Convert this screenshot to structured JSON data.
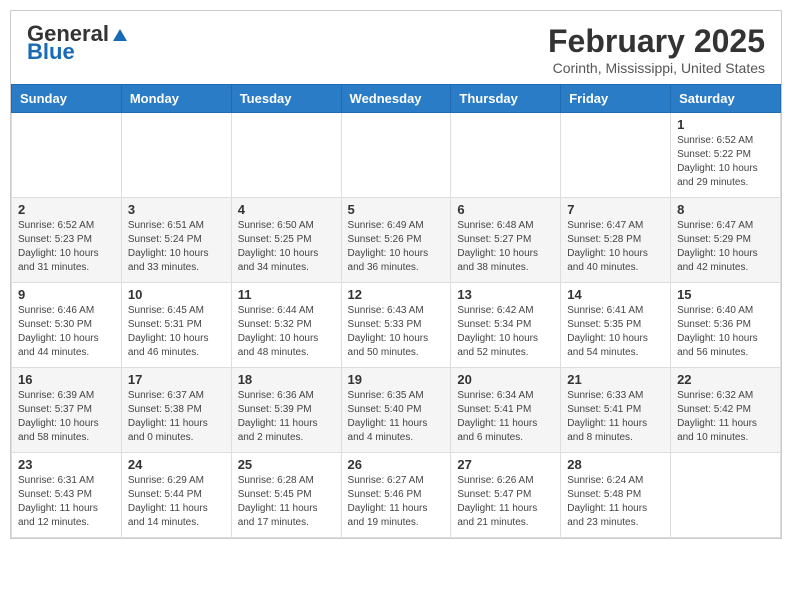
{
  "header": {
    "logo_general": "General",
    "logo_blue": "Blue",
    "month_title": "February 2025",
    "location": "Corinth, Mississippi, United States"
  },
  "days_of_week": [
    "Sunday",
    "Monday",
    "Tuesday",
    "Wednesday",
    "Thursday",
    "Friday",
    "Saturday"
  ],
  "weeks": [
    [
      {
        "day": "",
        "info": ""
      },
      {
        "day": "",
        "info": ""
      },
      {
        "day": "",
        "info": ""
      },
      {
        "day": "",
        "info": ""
      },
      {
        "day": "",
        "info": ""
      },
      {
        "day": "",
        "info": ""
      },
      {
        "day": "1",
        "info": "Sunrise: 6:52 AM\nSunset: 5:22 PM\nDaylight: 10 hours and 29 minutes."
      }
    ],
    [
      {
        "day": "2",
        "info": "Sunrise: 6:52 AM\nSunset: 5:23 PM\nDaylight: 10 hours and 31 minutes."
      },
      {
        "day": "3",
        "info": "Sunrise: 6:51 AM\nSunset: 5:24 PM\nDaylight: 10 hours and 33 minutes."
      },
      {
        "day": "4",
        "info": "Sunrise: 6:50 AM\nSunset: 5:25 PM\nDaylight: 10 hours and 34 minutes."
      },
      {
        "day": "5",
        "info": "Sunrise: 6:49 AM\nSunset: 5:26 PM\nDaylight: 10 hours and 36 minutes."
      },
      {
        "day": "6",
        "info": "Sunrise: 6:48 AM\nSunset: 5:27 PM\nDaylight: 10 hours and 38 minutes."
      },
      {
        "day": "7",
        "info": "Sunrise: 6:47 AM\nSunset: 5:28 PM\nDaylight: 10 hours and 40 minutes."
      },
      {
        "day": "8",
        "info": "Sunrise: 6:47 AM\nSunset: 5:29 PM\nDaylight: 10 hours and 42 minutes."
      }
    ],
    [
      {
        "day": "9",
        "info": "Sunrise: 6:46 AM\nSunset: 5:30 PM\nDaylight: 10 hours and 44 minutes."
      },
      {
        "day": "10",
        "info": "Sunrise: 6:45 AM\nSunset: 5:31 PM\nDaylight: 10 hours and 46 minutes."
      },
      {
        "day": "11",
        "info": "Sunrise: 6:44 AM\nSunset: 5:32 PM\nDaylight: 10 hours and 48 minutes."
      },
      {
        "day": "12",
        "info": "Sunrise: 6:43 AM\nSunset: 5:33 PM\nDaylight: 10 hours and 50 minutes."
      },
      {
        "day": "13",
        "info": "Sunrise: 6:42 AM\nSunset: 5:34 PM\nDaylight: 10 hours and 52 minutes."
      },
      {
        "day": "14",
        "info": "Sunrise: 6:41 AM\nSunset: 5:35 PM\nDaylight: 10 hours and 54 minutes."
      },
      {
        "day": "15",
        "info": "Sunrise: 6:40 AM\nSunset: 5:36 PM\nDaylight: 10 hours and 56 minutes."
      }
    ],
    [
      {
        "day": "16",
        "info": "Sunrise: 6:39 AM\nSunset: 5:37 PM\nDaylight: 10 hours and 58 minutes."
      },
      {
        "day": "17",
        "info": "Sunrise: 6:37 AM\nSunset: 5:38 PM\nDaylight: 11 hours and 0 minutes."
      },
      {
        "day": "18",
        "info": "Sunrise: 6:36 AM\nSunset: 5:39 PM\nDaylight: 11 hours and 2 minutes."
      },
      {
        "day": "19",
        "info": "Sunrise: 6:35 AM\nSunset: 5:40 PM\nDaylight: 11 hours and 4 minutes."
      },
      {
        "day": "20",
        "info": "Sunrise: 6:34 AM\nSunset: 5:41 PM\nDaylight: 11 hours and 6 minutes."
      },
      {
        "day": "21",
        "info": "Sunrise: 6:33 AM\nSunset: 5:41 PM\nDaylight: 11 hours and 8 minutes."
      },
      {
        "day": "22",
        "info": "Sunrise: 6:32 AM\nSunset: 5:42 PM\nDaylight: 11 hours and 10 minutes."
      }
    ],
    [
      {
        "day": "23",
        "info": "Sunrise: 6:31 AM\nSunset: 5:43 PM\nDaylight: 11 hours and 12 minutes."
      },
      {
        "day": "24",
        "info": "Sunrise: 6:29 AM\nSunset: 5:44 PM\nDaylight: 11 hours and 14 minutes."
      },
      {
        "day": "25",
        "info": "Sunrise: 6:28 AM\nSunset: 5:45 PM\nDaylight: 11 hours and 17 minutes."
      },
      {
        "day": "26",
        "info": "Sunrise: 6:27 AM\nSunset: 5:46 PM\nDaylight: 11 hours and 19 minutes."
      },
      {
        "day": "27",
        "info": "Sunrise: 6:26 AM\nSunset: 5:47 PM\nDaylight: 11 hours and 21 minutes."
      },
      {
        "day": "28",
        "info": "Sunrise: 6:24 AM\nSunset: 5:48 PM\nDaylight: 11 hours and 23 minutes."
      },
      {
        "day": "",
        "info": ""
      }
    ]
  ]
}
